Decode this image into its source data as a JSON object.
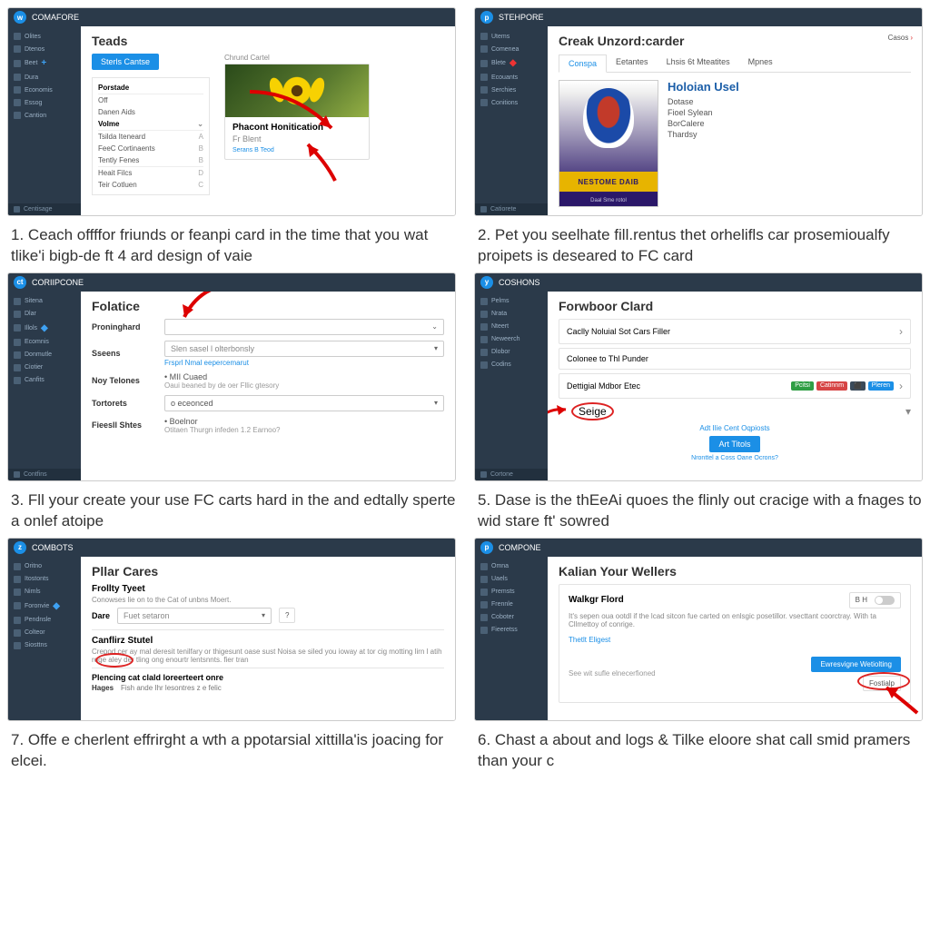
{
  "step1": {
    "brand": "COMAFORE",
    "sidebar": [
      "Olites",
      "Dtenos",
      "Beet",
      "Dura",
      "Economis",
      "Essog",
      "Cantion"
    ],
    "sidebar_footer": "Centisage",
    "title": "Teads",
    "button": "Sterls Cantse",
    "list_header": "Porstade",
    "filters": [
      "Off",
      "Danen Aids"
    ],
    "col_header": "Volme",
    "rows": [
      "Tsilda Iteneard",
      "FeeC Cortinaents",
      "Tently Fenes",
      "Heait Filcs",
      "Teir Cotluen"
    ],
    "card_head": "Chrund Cartel",
    "card_title": "Phacont Honitication",
    "card_sub": "Fr Blent",
    "card_link": "Serans B Teod",
    "caption_num": "1.",
    "caption": "Ceach offffor friunds or feanpi card in the time that you wat tlike'i bigb-de ft 4 ard design of vaie"
  },
  "step2": {
    "brand": "STEHPORE",
    "sidebar": [
      "Utems",
      "Comenea",
      "Blete",
      "Ecouants",
      "Serchies",
      "Conitions"
    ],
    "sidebar_footer": "Catiorete",
    "title": "Creak Unzord:carder",
    "tabs": [
      "Conspa",
      "Eetantes",
      "Lhsis 6t Mteatites",
      "Mpnes"
    ],
    "corner": "Casos",
    "poster_band": "NESTOME DAIB",
    "poster_foot": "Daal Sme rotol",
    "name": "Holoian Usel",
    "fields": [
      "Dotase",
      "Fioel Sylean",
      "BorCalere",
      "Thardsy"
    ],
    "caption_num": "2.",
    "caption": "Pet you seelhate fill.rentus thet orhelifls car prosemioualfy proipets is deseared to FC card"
  },
  "step3": {
    "brand": "CORIIPCONE",
    "sidebar": [
      "Sitena",
      "Dlar",
      "Illols",
      "Ecomnis",
      "Donmutle",
      "Ciotier",
      "Canfits"
    ],
    "sidebar_footer": "Contfins",
    "title": "Folatice",
    "rows": [
      {
        "label": "Proninghard",
        "val": ""
      },
      {
        "label": "Sseens",
        "val": "Slen sasel l olterbonsly",
        "hint": "Frsprl Nmal eepercemarut"
      },
      {
        "label": "Noy Telones",
        "val": "MII Cuaed",
        "sub": "Oaui beaned by de oer Fllic gtesory"
      },
      {
        "label": "Tortorets",
        "val": "o eceonced"
      },
      {
        "label": "Fieesll Shtes",
        "val": "Boelnor",
        "sub": "Otitaen Thurgn infeden 1.2 Earnoo?"
      }
    ],
    "caption_num": "3.",
    "caption": "Fll your create your use FC carts hard in the and edtally sperte a onlef atoipe"
  },
  "step5": {
    "brand": "COSHONS",
    "sidebar": [
      "Pelms",
      "Nrata",
      "Nteert",
      "Neweerch",
      "Dlobor",
      "Codins"
    ],
    "sidebar_footer": "Cortone",
    "title": "Forwboor Clard",
    "row1": "Caclly Noluial Sot Cars Filler",
    "row2": "Colonee to Thl Punder",
    "row3_label": "Dettigial Mdbor Etec",
    "badges": [
      "Pcitsi",
      "Catinnm",
      "Pleren"
    ],
    "saige": "Seige",
    "link": "Adt Ilie Cent Oqpiosts",
    "btn": "Art Titols",
    "footer": "Nronttel a Coss Oane Ocrons?",
    "caption_num": "5.",
    "caption": "Dase is the thEeAi quoes the flinly out cracige with a fnages to wid stare ft' sowred"
  },
  "step7": {
    "brand": "COMBOTS",
    "sidebar": [
      "Oritno",
      "Itostonts",
      "Nimls",
      "Foronvie",
      "Pendnsle",
      "Colteor",
      "Siosttns"
    ],
    "title": "Pllar Cares",
    "sub": "Frollty Tyeet",
    "desc": "Conowses lie on to the Cat of unbns Moert.",
    "date_label": "Dare",
    "date_val": "Fuet setaron",
    "section": "Canflirz Stutel",
    "section_body": "Crepod cer ay mal deresit tenilfary or thigesunt oase sust Noisa se siled you ioway at tor cig motting lirn l atih roge aley der tling ong enourtr lentsnnts. fier tran",
    "section2": "Plencing cat clald loreerteert onre",
    "hages": "Hages",
    "hages_desc": "Fish ande Ihr lesontres z e felic",
    "caption_num": "7.",
    "caption": "Offe e cherlent effrirght a wth a ppotarsial xittilla'is joacing for elcei."
  },
  "step6": {
    "brand": "COMPONE",
    "sidebar": [
      "Omna",
      "Uaels",
      "Premsts",
      "Frennle",
      "Coboter",
      "Fieeretss"
    ],
    "title": "Kalian Your Wellers",
    "sub": "Walkgr Flord",
    "toggle": "B H",
    "body": "It's sepen oua ootdl if the lcad sitcon fue carted on enlsgic posetillor. vsecttant coorctray. With ta Cllmettoy of conrige.",
    "link": "Thetlt Eligest",
    "foot": "See wit sufle elnecerfioned",
    "btn1": "Ewresvigne Wetiolting",
    "btn2": "Fostialp",
    "caption_num": "6.",
    "caption": "Chast a about and logs & Tilke eloore shat call smid pramers than your c"
  }
}
